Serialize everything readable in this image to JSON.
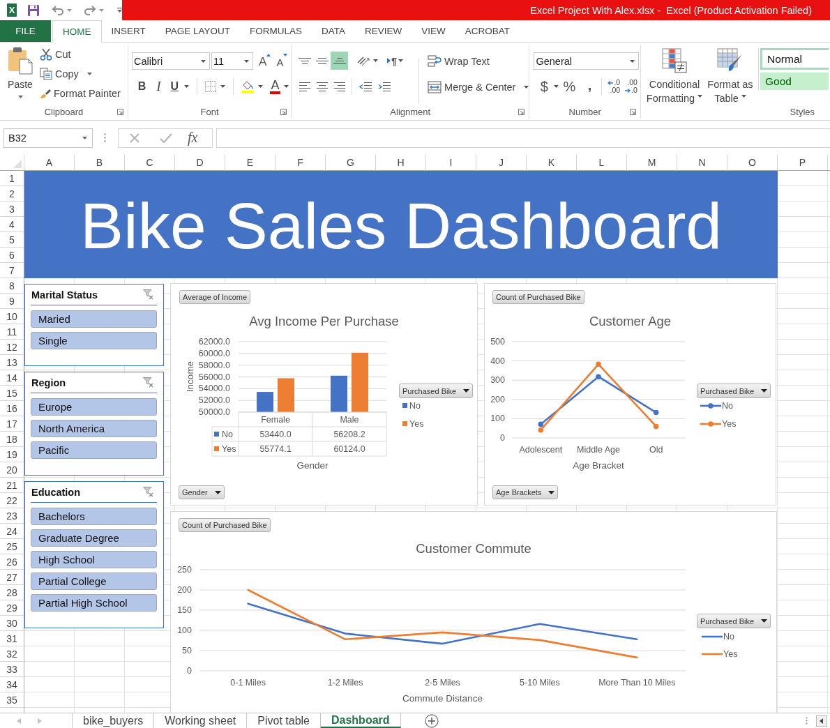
{
  "quick_access": {
    "logo": "X"
  },
  "window": {
    "title": "Excel Project With Alex.xlsx -  Excel (Product Activation Failed)"
  },
  "ribbon_tabs": [
    {
      "label": "FILE",
      "kind": "file",
      "selected": false
    },
    {
      "label": "HOME",
      "kind": "tab",
      "selected": true
    },
    {
      "label": "INSERT",
      "kind": "tab",
      "selected": false
    },
    {
      "label": "PAGE LAYOUT",
      "kind": "tab",
      "selected": false
    },
    {
      "label": "FORMULAS",
      "kind": "tab",
      "selected": false
    },
    {
      "label": "DATA",
      "kind": "tab",
      "selected": false
    },
    {
      "label": "REVIEW",
      "kind": "tab",
      "selected": false
    },
    {
      "label": "VIEW",
      "kind": "tab",
      "selected": false
    },
    {
      "label": "ACROBAT",
      "kind": "tab",
      "selected": false
    }
  ],
  "ribbon": {
    "clipboard": {
      "label": "Clipboard",
      "paste": "Paste",
      "cut": "Cut",
      "copy": "Copy",
      "format_painter": "Format Painter"
    },
    "font": {
      "label": "Font",
      "font_name": "Calibri",
      "font_size": "11",
      "grow_font": "A",
      "shrink_font": "A",
      "bold": "B",
      "italic": "I",
      "underline": "U",
      "font_color": "A"
    },
    "alignment": {
      "label": "Alignment",
      "vertical_align": [
        {
          "kind": "top",
          "selected": false
        },
        {
          "kind": "middle",
          "selected": false
        },
        {
          "kind": "bottom",
          "selected": true
        }
      ],
      "text_direction": "¶",
      "wrap_text": "Wrap Text",
      "merge_center": "Merge & Center"
    },
    "number": {
      "label": "Number",
      "format": "General",
      "currency": "$",
      "percent": "%",
      "comma": ",",
      "increase_decimal": {
        "top": ".0",
        "bottom": ".00"
      },
      "decrease_decimal": {
        "top": ".00",
        "bottom": ".0"
      }
    },
    "styles": {
      "label": "Styles",
      "conditional_formatting": [
        "Conditional",
        "Formatting"
      ],
      "format_as_table": [
        "Format as",
        "Table"
      ],
      "cell_styles": [
        {
          "label": "Normal",
          "kind": "normal"
        },
        {
          "label": "Good",
          "kind": "good"
        }
      ]
    }
  },
  "formula_bar": {
    "name_box": "B32",
    "function_label": "fx"
  },
  "sheet": {
    "columns": [
      "A",
      "B",
      "C",
      "D",
      "E",
      "F",
      "G",
      "H",
      "I",
      "J",
      "K",
      "L",
      "M",
      "N",
      "O",
      "P"
    ],
    "rows": [
      "1",
      "2",
      "3",
      "4",
      "5",
      "6",
      "7",
      "8",
      "9",
      "10",
      "11",
      "12",
      "13",
      "14",
      "15",
      "16",
      "17",
      "18",
      "19",
      "20",
      "21",
      "22",
      "23",
      "24",
      "25",
      "26",
      "27",
      "28",
      "29",
      "30",
      "31",
      "32",
      "33",
      "34",
      "35"
    ]
  },
  "dashboard": {
    "title": "Bike Sales Dashboard",
    "slicers": [
      {
        "title": "Marital Status",
        "items": [
          {
            "label": "Maried",
            "selected": true
          },
          {
            "label": "Single",
            "selected": true
          }
        ]
      },
      {
        "title": "Region",
        "items": [
          {
            "label": "Europe",
            "selected": true
          },
          {
            "label": "North America",
            "selected": true
          },
          {
            "label": "Pacific",
            "selected": true
          }
        ]
      },
      {
        "title": "Education",
        "items": [
          {
            "label": "Bachelors",
            "selected": true
          },
          {
            "label": "Graduate Degree",
            "selected": true
          },
          {
            "label": "High School",
            "selected": true
          },
          {
            "label": "Partial College",
            "selected": true
          },
          {
            "label": "Partial High School",
            "selected": true
          }
        ]
      }
    ],
    "charts": [
      {
        "value_button": "Average of Income",
        "axis_button": "Gender",
        "legend_button": "Purchased Bike",
        "data_table": {
          "rows": [
            {
              "label": "No",
              "cells": [
                "53440.0",
                "56208.2"
              ]
            },
            {
              "label": "Yes",
              "cells": [
                "55774.1",
                "60124.0"
              ]
            }
          ]
        },
        "chart_data": {
          "type": "bar",
          "title": "Avg Income Per Purchase",
          "xlabel": "Gender",
          "ylabel": "Income",
          "categories": [
            "Female",
            "Male"
          ],
          "series": [
            {
              "name": "No",
              "color": "#4472c4",
              "values": [
                53440.0,
                56208.2
              ]
            },
            {
              "name": "Yes",
              "color": "#ed7d31",
              "values": [
                55774.1,
                60124.0
              ]
            }
          ],
          "ylim": [
            50000,
            62000
          ],
          "yticks": [
            {
              "value": 50000,
              "label": "50000.0"
            },
            {
              "value": 52000,
              "label": "52000.0"
            },
            {
              "value": 54000,
              "label": "54000.0"
            },
            {
              "value": 56000,
              "label": "56000.0"
            },
            {
              "value": 58000,
              "label": "58000.0"
            },
            {
              "value": 60000,
              "label": "60000.0"
            },
            {
              "value": 62000,
              "label": "62000.0"
            }
          ],
          "grid": true,
          "legend": "right"
        }
      },
      {
        "value_button": "Count of Purchased Bike",
        "axis_button": "Age Brackets",
        "legend_button": "Purchased Bike",
        "chart_data": {
          "type": "line",
          "title": "Customer Age",
          "xlabel": "Age Bracket",
          "categories": [
            "Adolescent",
            "Middle Age",
            "Old"
          ],
          "series": [
            {
              "name": "No",
              "color": "#4472c4",
              "values": [
                71,
                318,
                132
              ],
              "marker": "circle"
            },
            {
              "name": "Yes",
              "color": "#ed7d31",
              "values": [
                41,
                383,
                60
              ],
              "marker": "circle"
            }
          ],
          "ylim": [
            0,
            500
          ],
          "yticks": [
            0,
            100,
            200,
            300,
            400,
            500
          ],
          "grid": true,
          "legend": "right"
        }
      },
      {
        "value_button": "Count of Purchased Bike",
        "legend_button": "Purchased Bike",
        "chart_data": {
          "type": "line",
          "title": "Customer Commute",
          "xlabel": "Commute Distance",
          "categories": [
            "0-1 Miles",
            "1-2 Miles",
            "2-5 Miles",
            "5-10 Miles",
            "More Than 10 Miles"
          ],
          "series": [
            {
              "name": "No",
              "color": "#4472c4",
              "values": [
                166,
                92,
                67,
                116,
                78
              ]
            },
            {
              "name": "Yes",
              "color": "#ed7d31",
              "values": [
                200,
                78,
                95,
                76,
                33
              ]
            }
          ],
          "ylim": [
            0,
            250
          ],
          "yticks": [
            0,
            50,
            100,
            150,
            200,
            250
          ],
          "grid": true,
          "legend": "right"
        }
      }
    ]
  },
  "sheet_tabs": [
    {
      "label": "bike_buyers",
      "selected": false
    },
    {
      "label": "Working sheet",
      "selected": false
    },
    {
      "label": "Pivot table",
      "selected": false
    },
    {
      "label": "Dashboard",
      "selected": true
    }
  ]
}
